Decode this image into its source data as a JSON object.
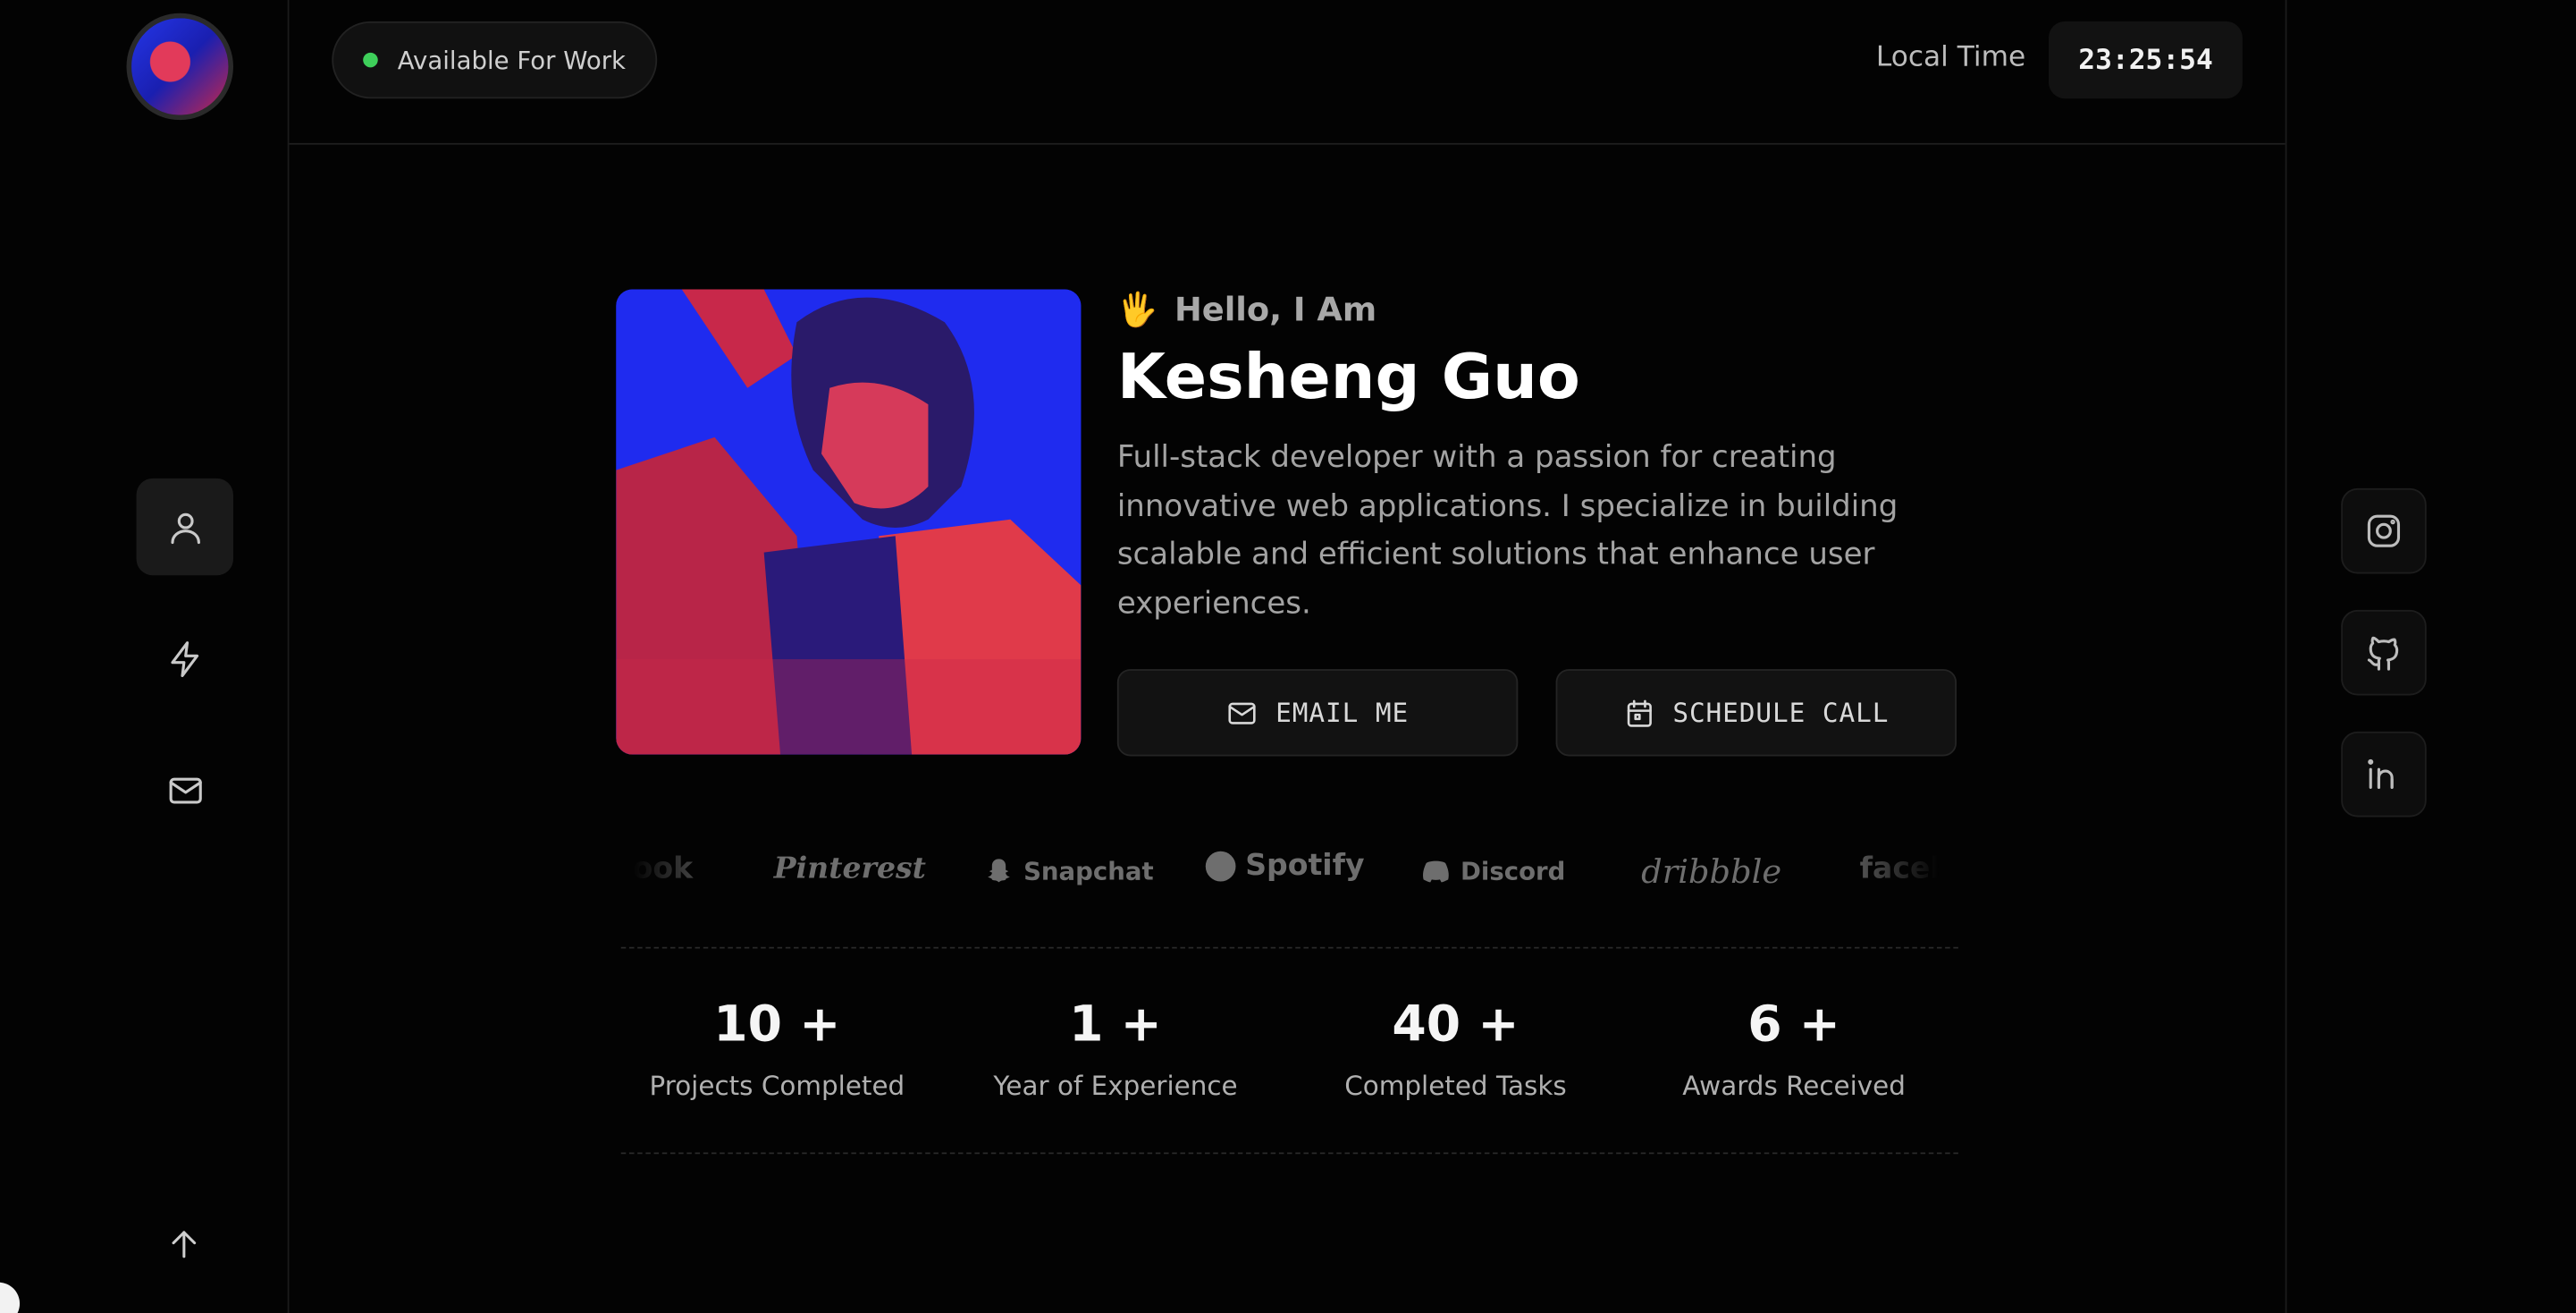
{
  "header": {
    "status_label": "Available For Work",
    "status_color": "#3ecf5a",
    "local_time_label": "Local Time",
    "local_time_value": "23:25:54"
  },
  "sidebar": {
    "items": [
      {
        "icon": "user-icon",
        "active": true
      },
      {
        "icon": "lightning-icon",
        "active": false
      },
      {
        "icon": "mail-icon",
        "active": false
      }
    ],
    "scroll_top_icon": "arrow-up-icon"
  },
  "hero": {
    "greeting_emoji": "🖐",
    "greeting": "Hello, I Am",
    "name": "Kesheng Guo",
    "bio": "Full-stack developer with a passion for creating innovative web applications. I specialize in building scalable and efficient solutions that enhance user experiences.",
    "email_button": "EMAIL ME",
    "schedule_button": "SCHEDULE CALL"
  },
  "logos": [
    {
      "name": "ook"
    },
    {
      "name": "Pinterest"
    },
    {
      "name": "Snapchat"
    },
    {
      "name": "Spotify"
    },
    {
      "name": "Discord"
    },
    {
      "name": "dribbble"
    },
    {
      "name": "faceb"
    }
  ],
  "stats": [
    {
      "value": "10 +",
      "label": "Projects Completed"
    },
    {
      "value": "1 +",
      "label": "Year of Experience"
    },
    {
      "value": "40 +",
      "label": "Completed Tasks"
    },
    {
      "value": "6 +",
      "label": "Awards Received"
    }
  ],
  "social": [
    {
      "icon": "instagram-icon"
    },
    {
      "icon": "github-icon"
    },
    {
      "icon": "linkedin-icon"
    }
  ],
  "colors": {
    "background": "#030303",
    "accent_blue": "#1f2bef",
    "accent_red": "#e23a5a"
  }
}
